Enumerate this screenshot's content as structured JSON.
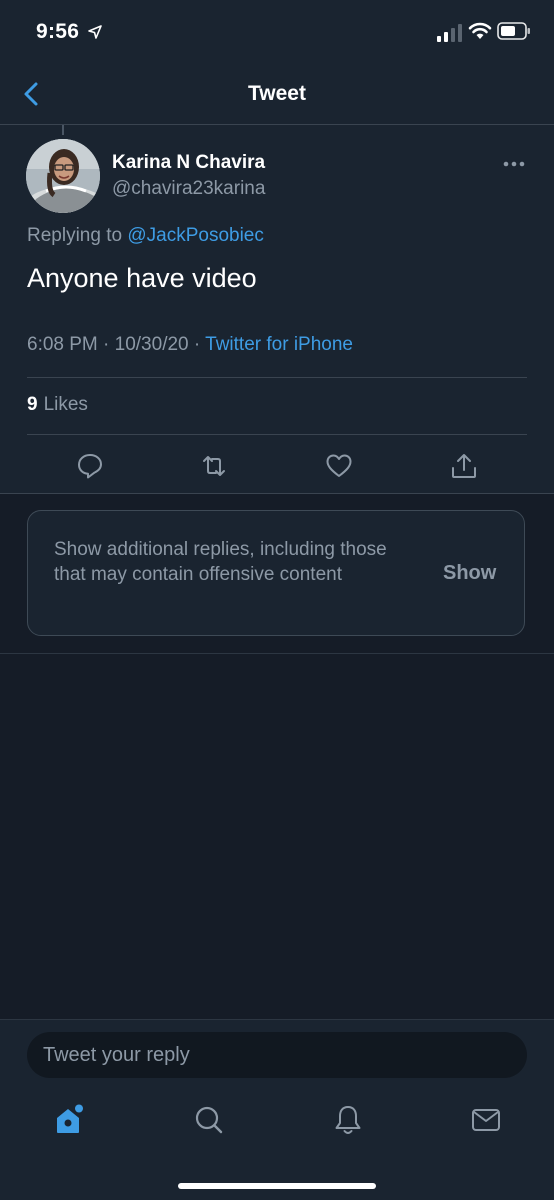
{
  "status_bar": {
    "time": "9:56"
  },
  "header": {
    "title": "Tweet"
  },
  "tweet": {
    "display_name": "Karina N Chavira",
    "handle": "@chavira23karina",
    "replying_prefix": "Replying to",
    "replying_to": "@JackPosobiec",
    "text": "Anyone have video",
    "timestamp": "6:08 PM · 10/30/20 ·",
    "source": "Twitter for iPhone",
    "likes_count": "9",
    "likes_label": "Likes"
  },
  "additional_replies": {
    "text": "Show additional replies, including those that may contain offensive content",
    "button_label": "Show"
  },
  "compose": {
    "placeholder": "Tweet your reply"
  },
  "tabs": [
    {
      "icon": "home-icon",
      "active": true
    },
    {
      "icon": "search-icon",
      "active": false
    },
    {
      "icon": "notifications-icon",
      "active": false
    },
    {
      "icon": "messages-icon",
      "active": false
    }
  ],
  "colors": {
    "background": "#151c27",
    "surface": "#1a2430",
    "accent": "#3e9ce4",
    "secondary_text": "#8d99a6"
  }
}
